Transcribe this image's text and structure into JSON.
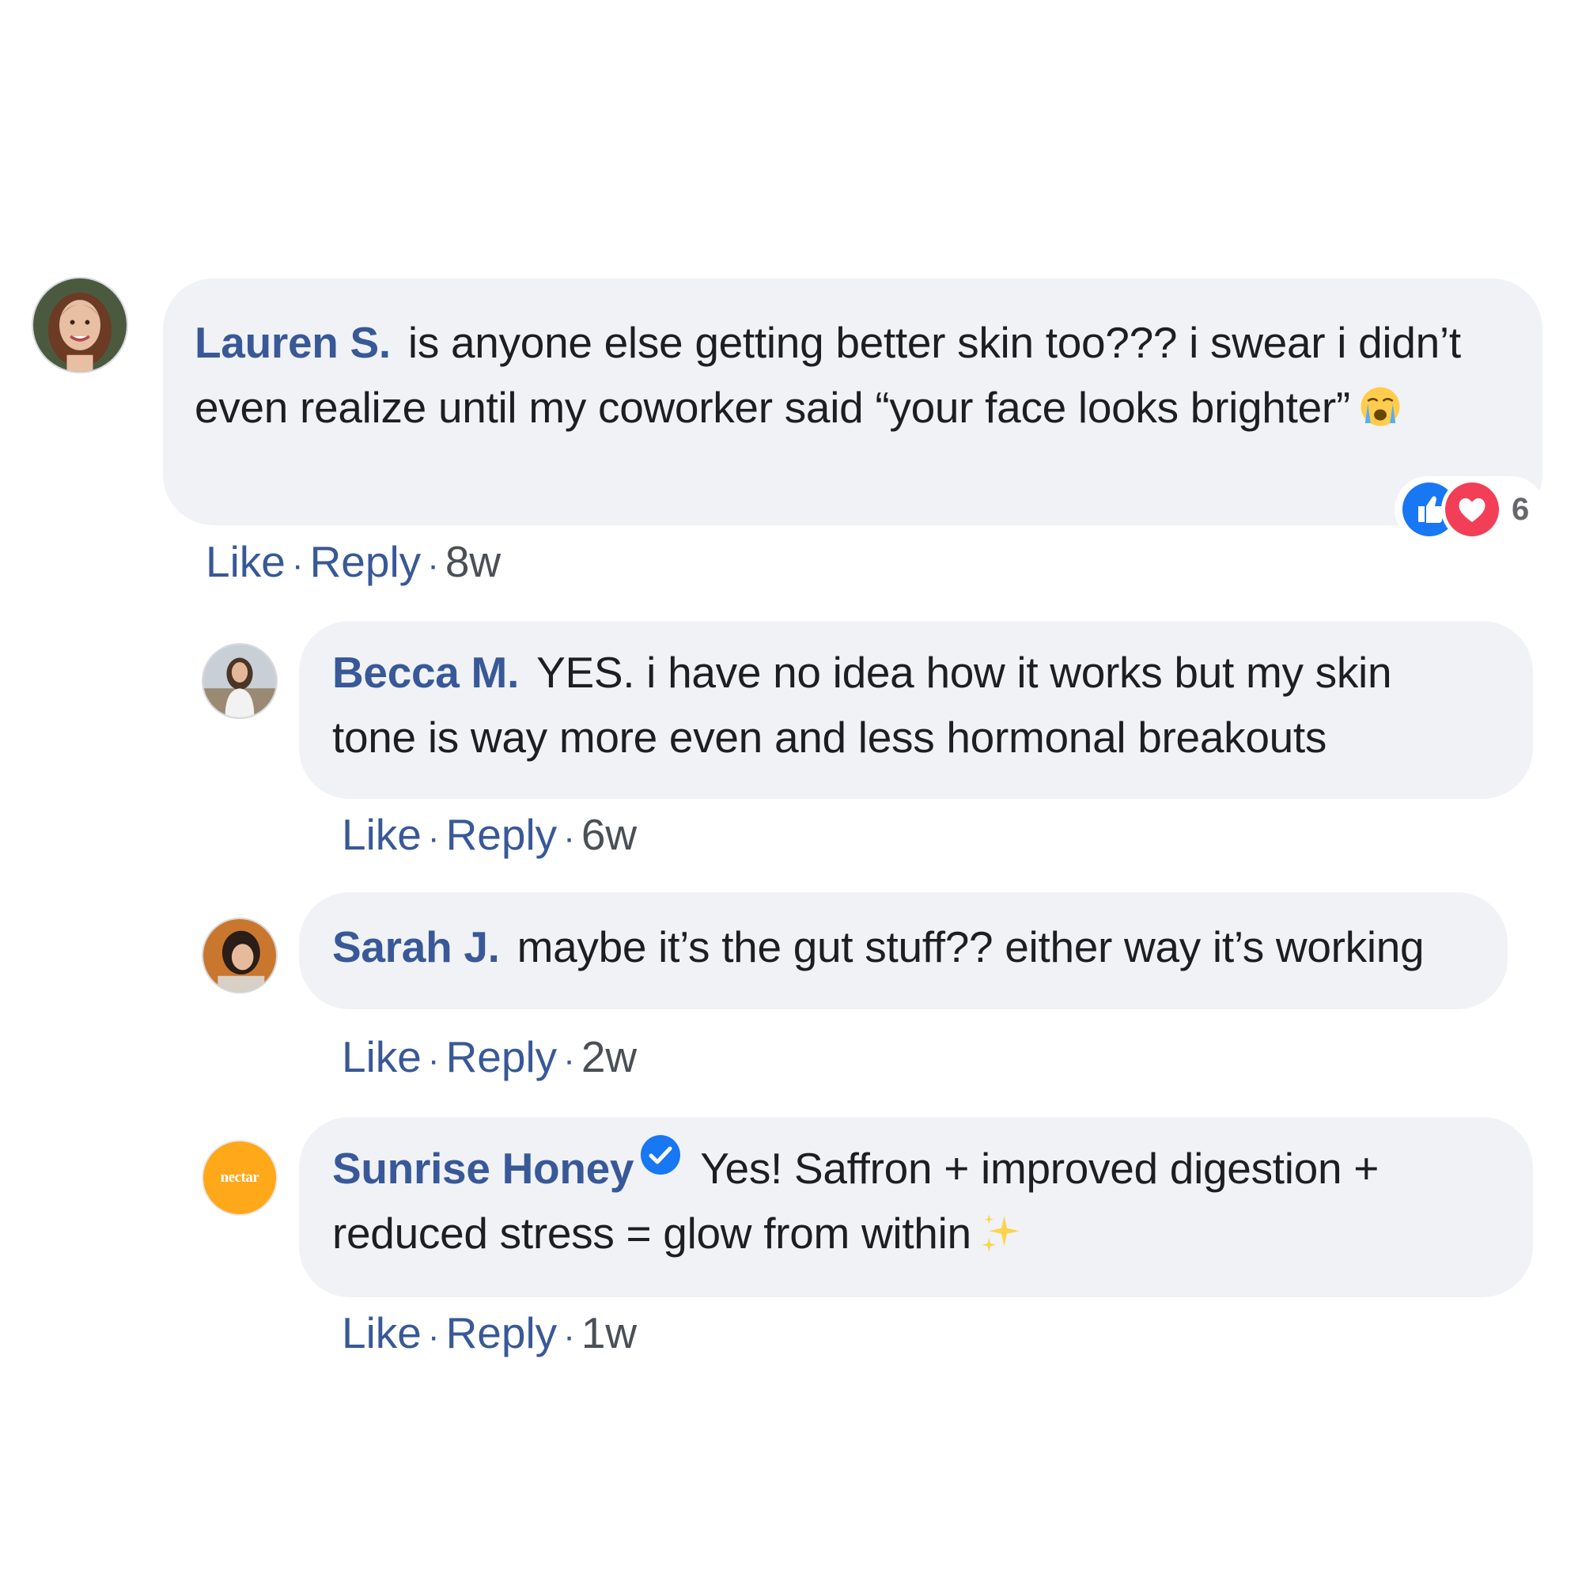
{
  "comments": [
    {
      "author": "Lauren S.",
      "text": "is anyone else getting better skin too??? i swear i didn’t even realize until my coworker said “your face looks brighter”",
      "emoji": "loudly-crying-face",
      "like": "Like",
      "reply": "Reply",
      "time": "8w",
      "reactions": {
        "types": [
          "like",
          "love"
        ],
        "count": "6"
      }
    },
    {
      "author": "Becca M.",
      "text": "YES. i have no idea how it works but my skin tone is way more even and less hormonal breakouts",
      "like": "Like",
      "reply": "Reply",
      "time": "6w"
    },
    {
      "author": "Sarah J.",
      "text": "maybe it’s the gut stuff?? either way it’s working",
      "like": "Like",
      "reply": "Reply",
      "time": "2w"
    },
    {
      "author": "Sunrise Honey",
      "verified": true,
      "avatar_text": "nectar",
      "text": "Yes! Saffron + improved digestion + reduced stress = glow from within",
      "emoji": "sparkles",
      "like": "Like",
      "reply": "Reply",
      "time": "1w"
    }
  ],
  "separator": "·",
  "colors": {
    "author": "#385898",
    "bubble": "#f0f2f5",
    "brand_avatar": "#ffa81a",
    "verified": "#1877f2"
  }
}
